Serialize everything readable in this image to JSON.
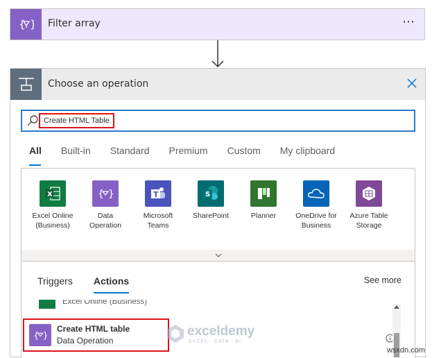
{
  "filter_card": {
    "title": "Filter array",
    "more": "⋯"
  },
  "operation_card": {
    "title": "Choose an operation",
    "search": {
      "value": "Create HTML Table"
    },
    "tabs": [
      {
        "label": "All"
      },
      {
        "label": "Built-in"
      },
      {
        "label": "Standard"
      },
      {
        "label": "Premium"
      },
      {
        "label": "Custom"
      },
      {
        "label": "My clipboard"
      }
    ],
    "connectors": [
      {
        "line1": "Excel Online",
        "line2": "(Business)",
        "color": "#107c41",
        "icon": "excel-icon"
      },
      {
        "line1": "Data",
        "line2": "Operation",
        "color": "#8661c5",
        "icon": "data-operation-icon"
      },
      {
        "line1": "Microsoft",
        "line2": "Teams",
        "color": "#4b53bc",
        "icon": "teams-icon"
      },
      {
        "line1": "SharePoint",
        "line2": "",
        "color": "#036c70",
        "icon": "sharepoint-icon"
      },
      {
        "line1": "Planner",
        "line2": "",
        "color": "#31752f",
        "icon": "planner-icon"
      },
      {
        "line1": "OneDrive for",
        "line2": "Business",
        "color": "#0364b8",
        "icon": "onedrive-icon"
      },
      {
        "line1": "Azure Table",
        "line2": "Storage",
        "color": "#804998",
        "icon": "azure-table-icon"
      }
    ],
    "sub_tabs": [
      {
        "label": "Triggers"
      },
      {
        "label": "Actions"
      }
    ],
    "see_more": "See more",
    "partial_item": "Excel Online (Business)",
    "action": {
      "title": "Create HTML table",
      "subtitle": "Data Operation"
    }
  },
  "watermark": {
    "name": "exceldemy",
    "tagline": "EXCEL · DATA · BI"
  },
  "corner_mark": "wsxdn.com"
}
